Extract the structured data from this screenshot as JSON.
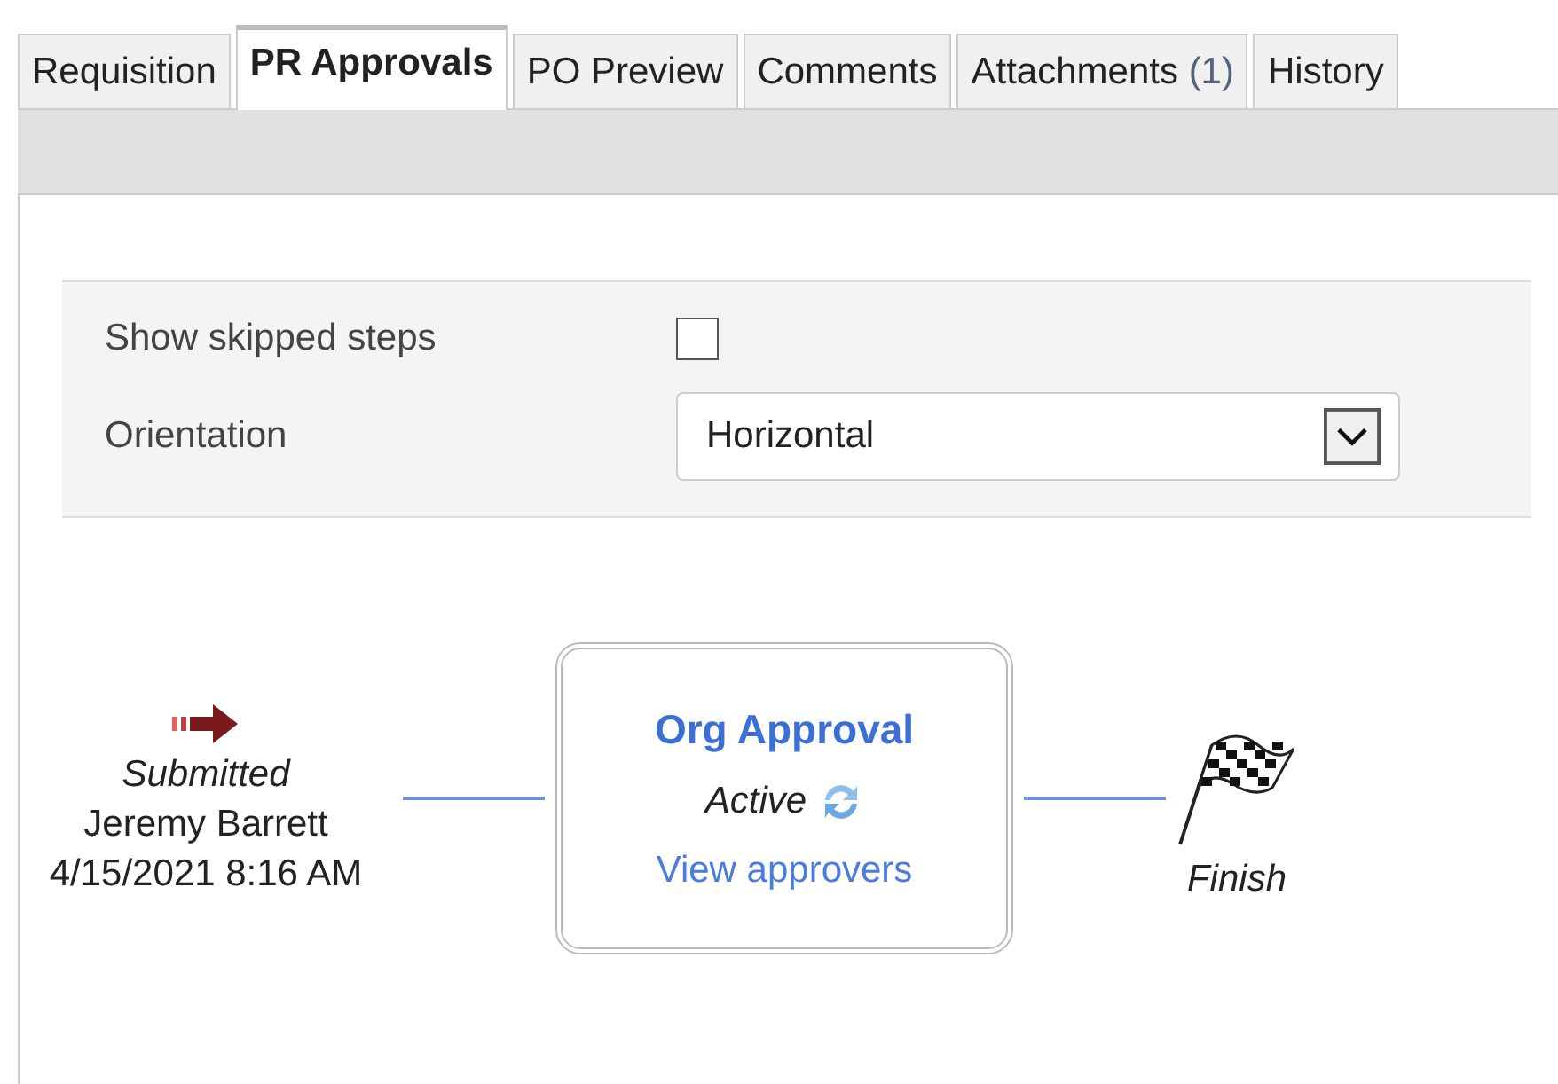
{
  "tabs": [
    {
      "label": "Requisition",
      "selected": false
    },
    {
      "label": "PR Approvals",
      "selected": true
    },
    {
      "label": "PO Preview",
      "selected": false
    },
    {
      "label": "Comments",
      "selected": false
    },
    {
      "label": "Attachments",
      "count": "(1)",
      "selected": false
    },
    {
      "label": "History",
      "selected": false
    }
  ],
  "options": {
    "show_skipped_label": "Show skipped steps",
    "show_skipped_checked": false,
    "orientation_label": "Orientation",
    "orientation_value": "Horizontal"
  },
  "workflow": {
    "start": {
      "status": "Submitted",
      "name": "Jeremy Barrett",
      "date": "4/15/2021 8:16 AM"
    },
    "steps": [
      {
        "title": "Org Approval",
        "status": "Active",
        "link": "View approvers"
      }
    ],
    "finish": {
      "label": "Finish"
    }
  }
}
